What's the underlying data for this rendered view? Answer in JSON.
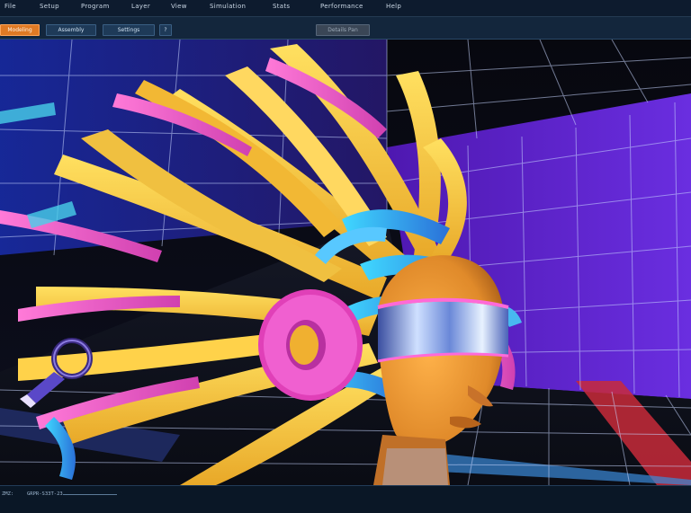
{
  "menu": {
    "items": [
      "File",
      "Setup",
      "Program",
      "Layer",
      "View",
      "Simulation",
      "Stats",
      "Performance",
      "Help"
    ]
  },
  "toolbar": {
    "tab1": "Modeling",
    "tab2": "Assembly",
    "tab3": "Settings",
    "help": "?",
    "right_btn": "Details Pan"
  },
  "status": {
    "left": "ZMZ:",
    "code": "GRPR-S33T-23"
  },
  "colors": {
    "accent": "#e07a24",
    "grid": "#c8d6ff",
    "wall": "#7a2ee0",
    "floor_red": "#d03040",
    "floor_blue": "#3a90d8"
  }
}
